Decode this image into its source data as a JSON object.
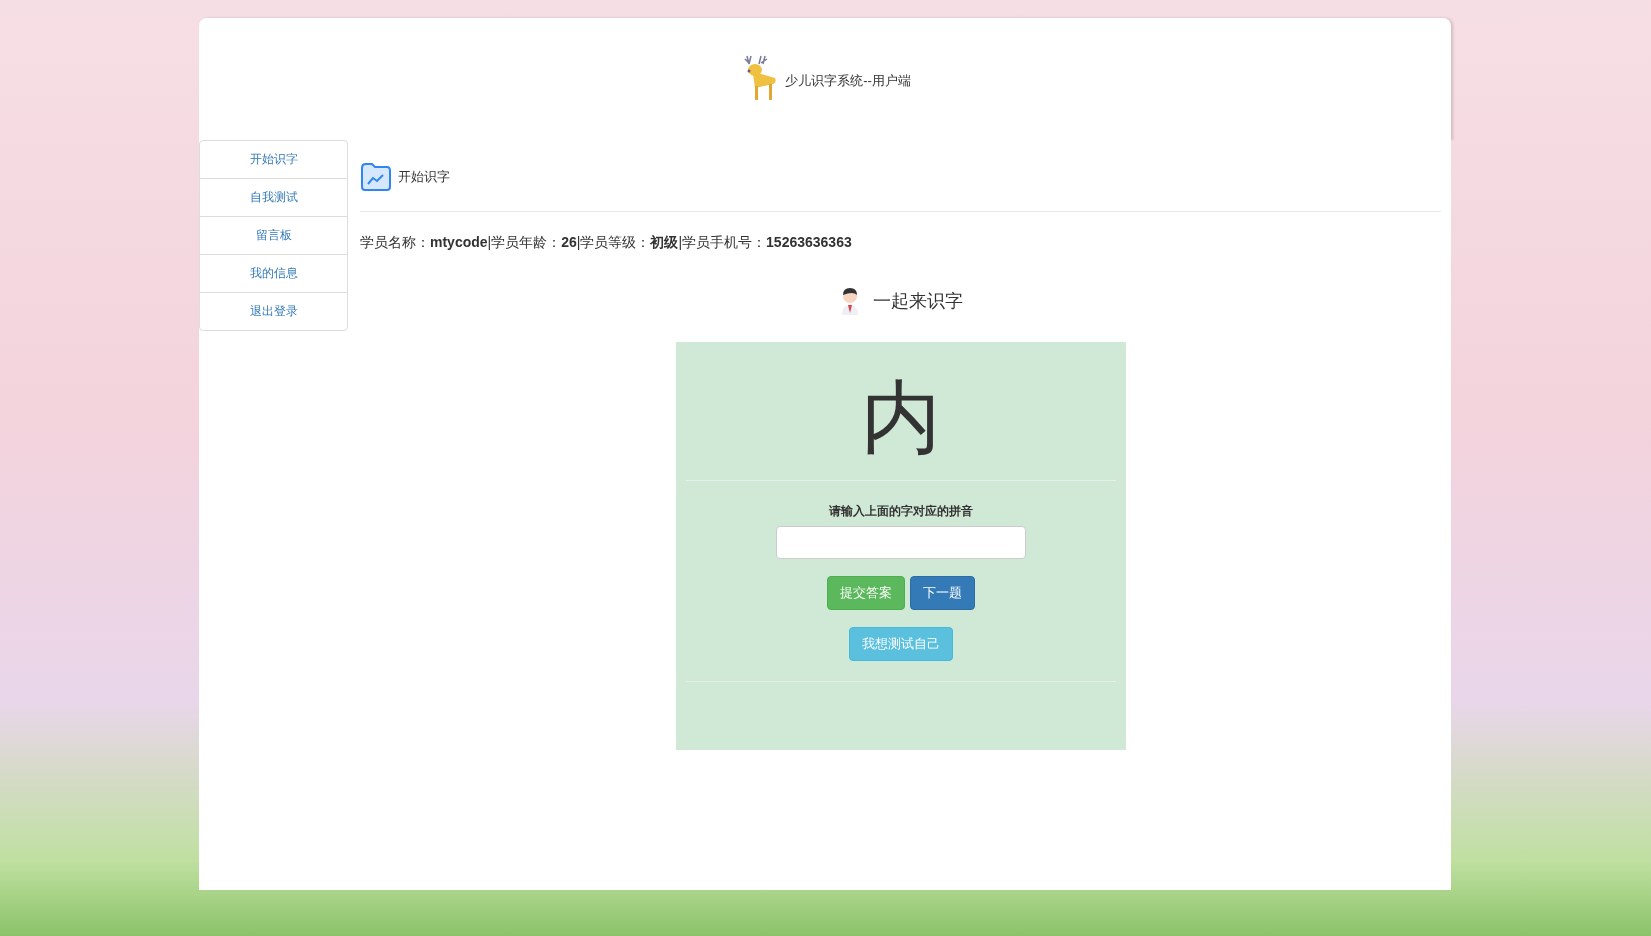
{
  "header": {
    "title": "少儿识字系统--用户端"
  },
  "sidebar": {
    "items": [
      {
        "label": "开始识字"
      },
      {
        "label": "自我测试"
      },
      {
        "label": "留言板"
      },
      {
        "label": "我的信息"
      },
      {
        "label": "退出登录"
      }
    ]
  },
  "page": {
    "heading": "开始识字",
    "student_info": "学员名称：**mtycode**|学员年龄：**26**|学员等级：**初级**|学员手机号：**15263636363**"
  },
  "quiz": {
    "title": "一起来识字",
    "character": "内",
    "prompt": "请输入上面的字对应的拼音",
    "buttons": [
      {
        "label": "提交答案",
        "kind": "success"
      },
      {
        "label": "下一题",
        "kind": "primary"
      }
    ],
    "self_test_button": "我想测试自己"
  }
}
